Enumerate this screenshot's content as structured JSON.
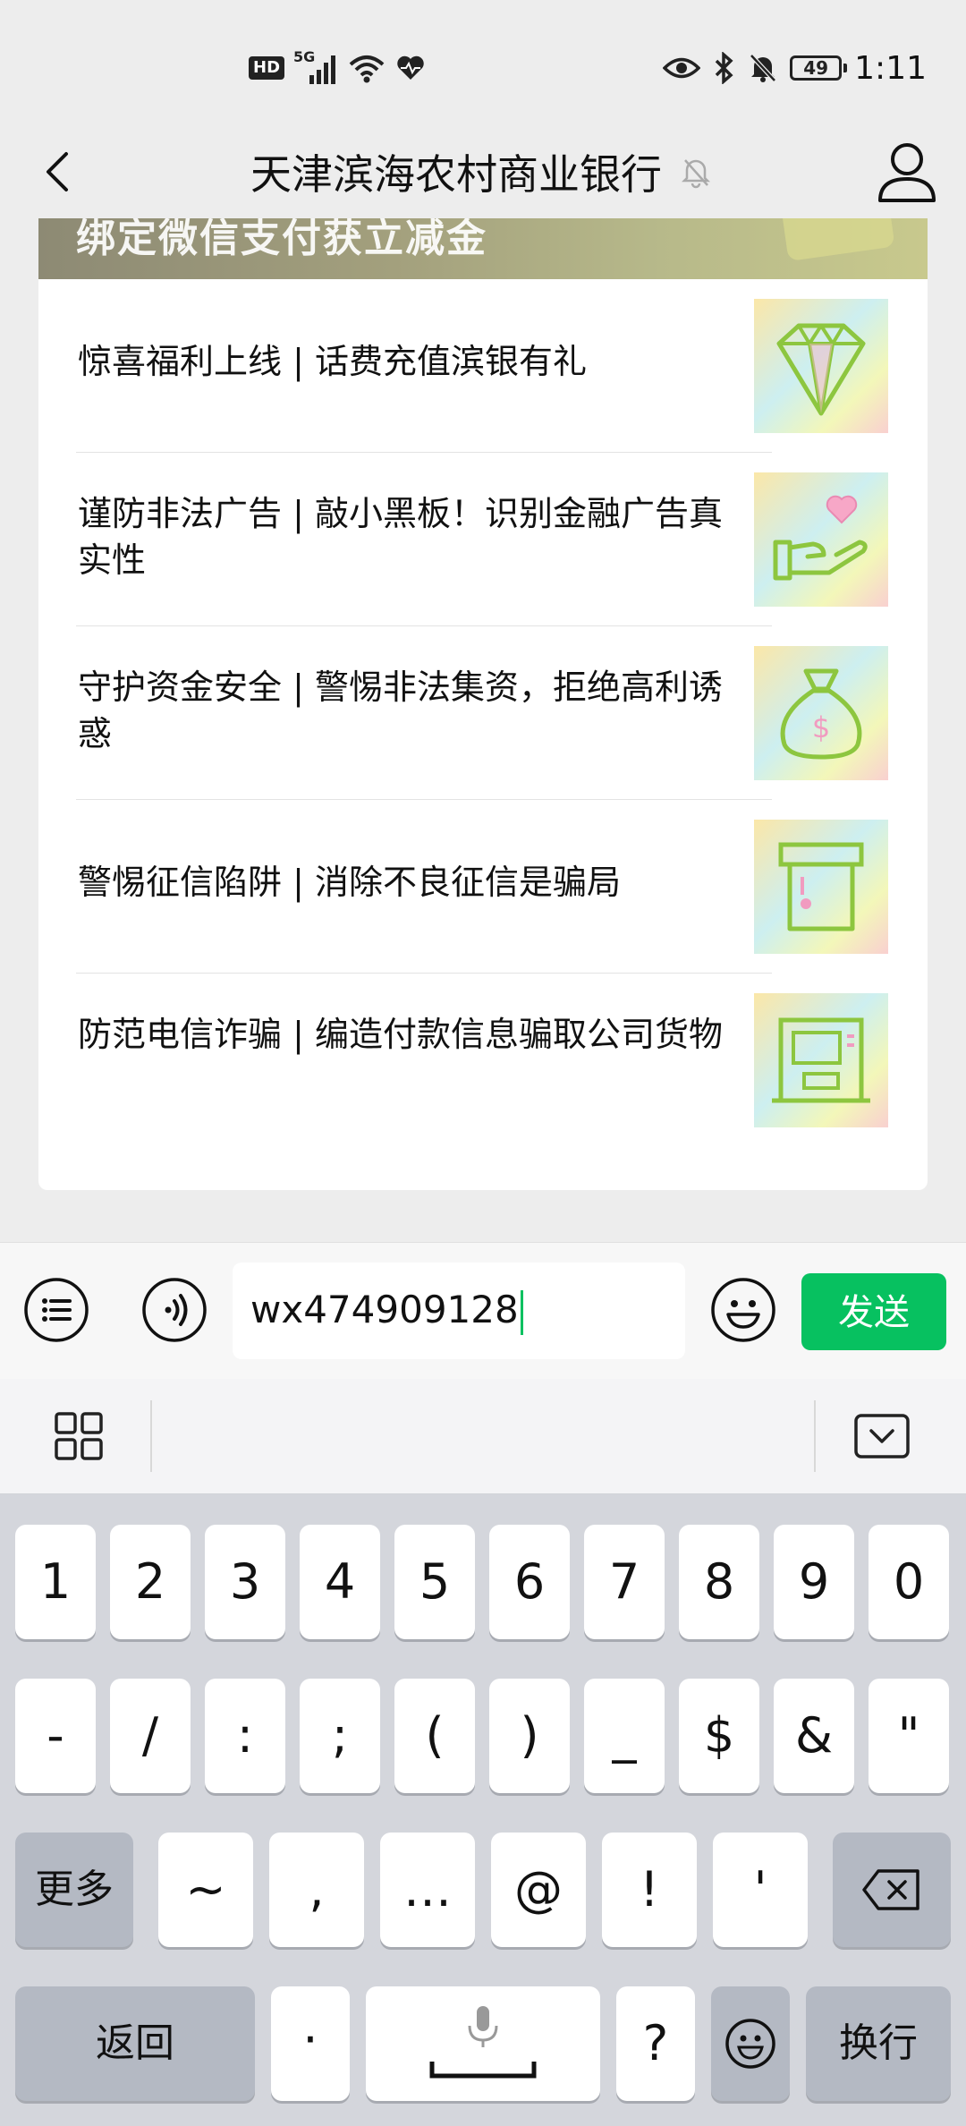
{
  "status_bar": {
    "hd": "HD",
    "net": "5G",
    "battery": "49",
    "time": "1:11"
  },
  "header": {
    "title": "天津滨海农村商业银行"
  },
  "banner": {
    "text": "绑定微信支付获立减金"
  },
  "articles": [
    {
      "title": "惊喜福利上线 | 话费充值滨银有礼",
      "icon": "diamond-icon"
    },
    {
      "title": "谨防非法广告 | 敲小黑板！识别金融广告真实性",
      "icon": "hand-heart-icon"
    },
    {
      "title": "守护资金安全 | 警惕非法集资，拒绝高利诱惑",
      "icon": "money-bag-icon"
    },
    {
      "title": "警惕征信陷阱 | 消除不良征信是骗局",
      "icon": "card-slot-icon"
    },
    {
      "title": "防范电信诈骗 | 编造付款信息骗取公司货物",
      "icon": "atm-icon"
    }
  ],
  "input_bar": {
    "value": "wx474909128",
    "send_label": "发送"
  },
  "keyboard": {
    "row1": [
      "1",
      "2",
      "3",
      "4",
      "5",
      "6",
      "7",
      "8",
      "9",
      "0"
    ],
    "row2": [
      "-",
      "/",
      ":",
      ";",
      "(",
      ")",
      "_",
      "$",
      "&",
      "\""
    ],
    "row3": [
      "~",
      ",",
      "…",
      "@",
      "!",
      "'"
    ],
    "more": "更多",
    "back": "返回",
    "dot": "·",
    "question": "?",
    "enter": "换行"
  },
  "colors": {
    "accent": "#07c160",
    "card_bg": "#ffffff",
    "page_bg": "#ededed",
    "keyboard_bg": "#d4d6dc"
  }
}
